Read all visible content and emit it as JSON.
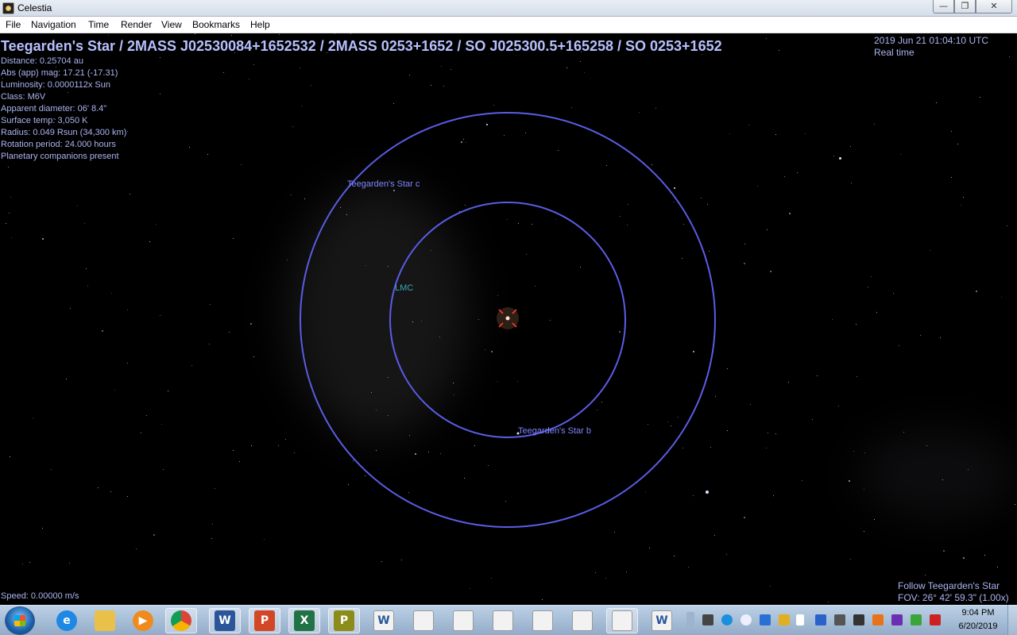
{
  "window": {
    "title": "Celestia",
    "min_glyph": "—",
    "max_glyph": "❐",
    "close_glyph": "✕"
  },
  "menu": [
    "File",
    "Navigation",
    "Time",
    "Render",
    "View",
    "Bookmarks",
    "Help"
  ],
  "hud": {
    "object_title": "Teegarden's Star / 2MASS J02530084+1652532 / 2MASS 0253+1652 / SO J025300.5+165258 / SO 0253+1652",
    "info": [
      "Distance: 0.25704 au",
      "Abs (app) mag: 17.21 (-17.31)",
      "Luminosity: 0.0000112x Sun",
      "Class: M6V",
      "Apparent diameter: 06' 8.4\"",
      "Surface temp: 3,050 K",
      "Radius: 0.049 Rsun  (34,300 km)",
      "Rotation period: 24.000 hours",
      "Planetary companions present"
    ],
    "datetime": "2019 Jun 21 01:04:10 UTC",
    "time_mode": "Real time",
    "speed": "Speed: 0.00000 m/s",
    "follow": "Follow Teegarden's Star",
    "fov": "FOV: 26° 42' 59.3\" (1.00x)"
  },
  "scene": {
    "orbit_color": "#5b5ce6",
    "marker_color": "#ff3a2a",
    "labels": {
      "planet_c": "Teegarden's Star c",
      "planet_b": "Teegarden's Star b",
      "galaxy": "LMC"
    }
  },
  "taskbar": {
    "clock_time": "9:04 PM",
    "clock_date": "6/20/2019",
    "apps": [
      {
        "name": "internet-explorer-icon"
      },
      {
        "name": "file-explorer-icon"
      },
      {
        "name": "media-player-icon"
      },
      {
        "name": "chrome-icon"
      },
      {
        "name": "word-icon",
        "glyph": "W"
      },
      {
        "name": "powerpoint-icon",
        "glyph": "P"
      },
      {
        "name": "excel-icon",
        "glyph": "X"
      },
      {
        "name": "publisher-icon",
        "glyph": "P"
      },
      {
        "name": "word-doc-icon",
        "glyph": "W"
      },
      {
        "name": "document-icon"
      },
      {
        "name": "tools-icon"
      },
      {
        "name": "mail-icon"
      },
      {
        "name": "notes-icon"
      },
      {
        "name": "edit-icon"
      },
      {
        "name": "celestia-icon"
      },
      {
        "name": "word-doc-2-icon",
        "glyph": "W"
      }
    ]
  }
}
